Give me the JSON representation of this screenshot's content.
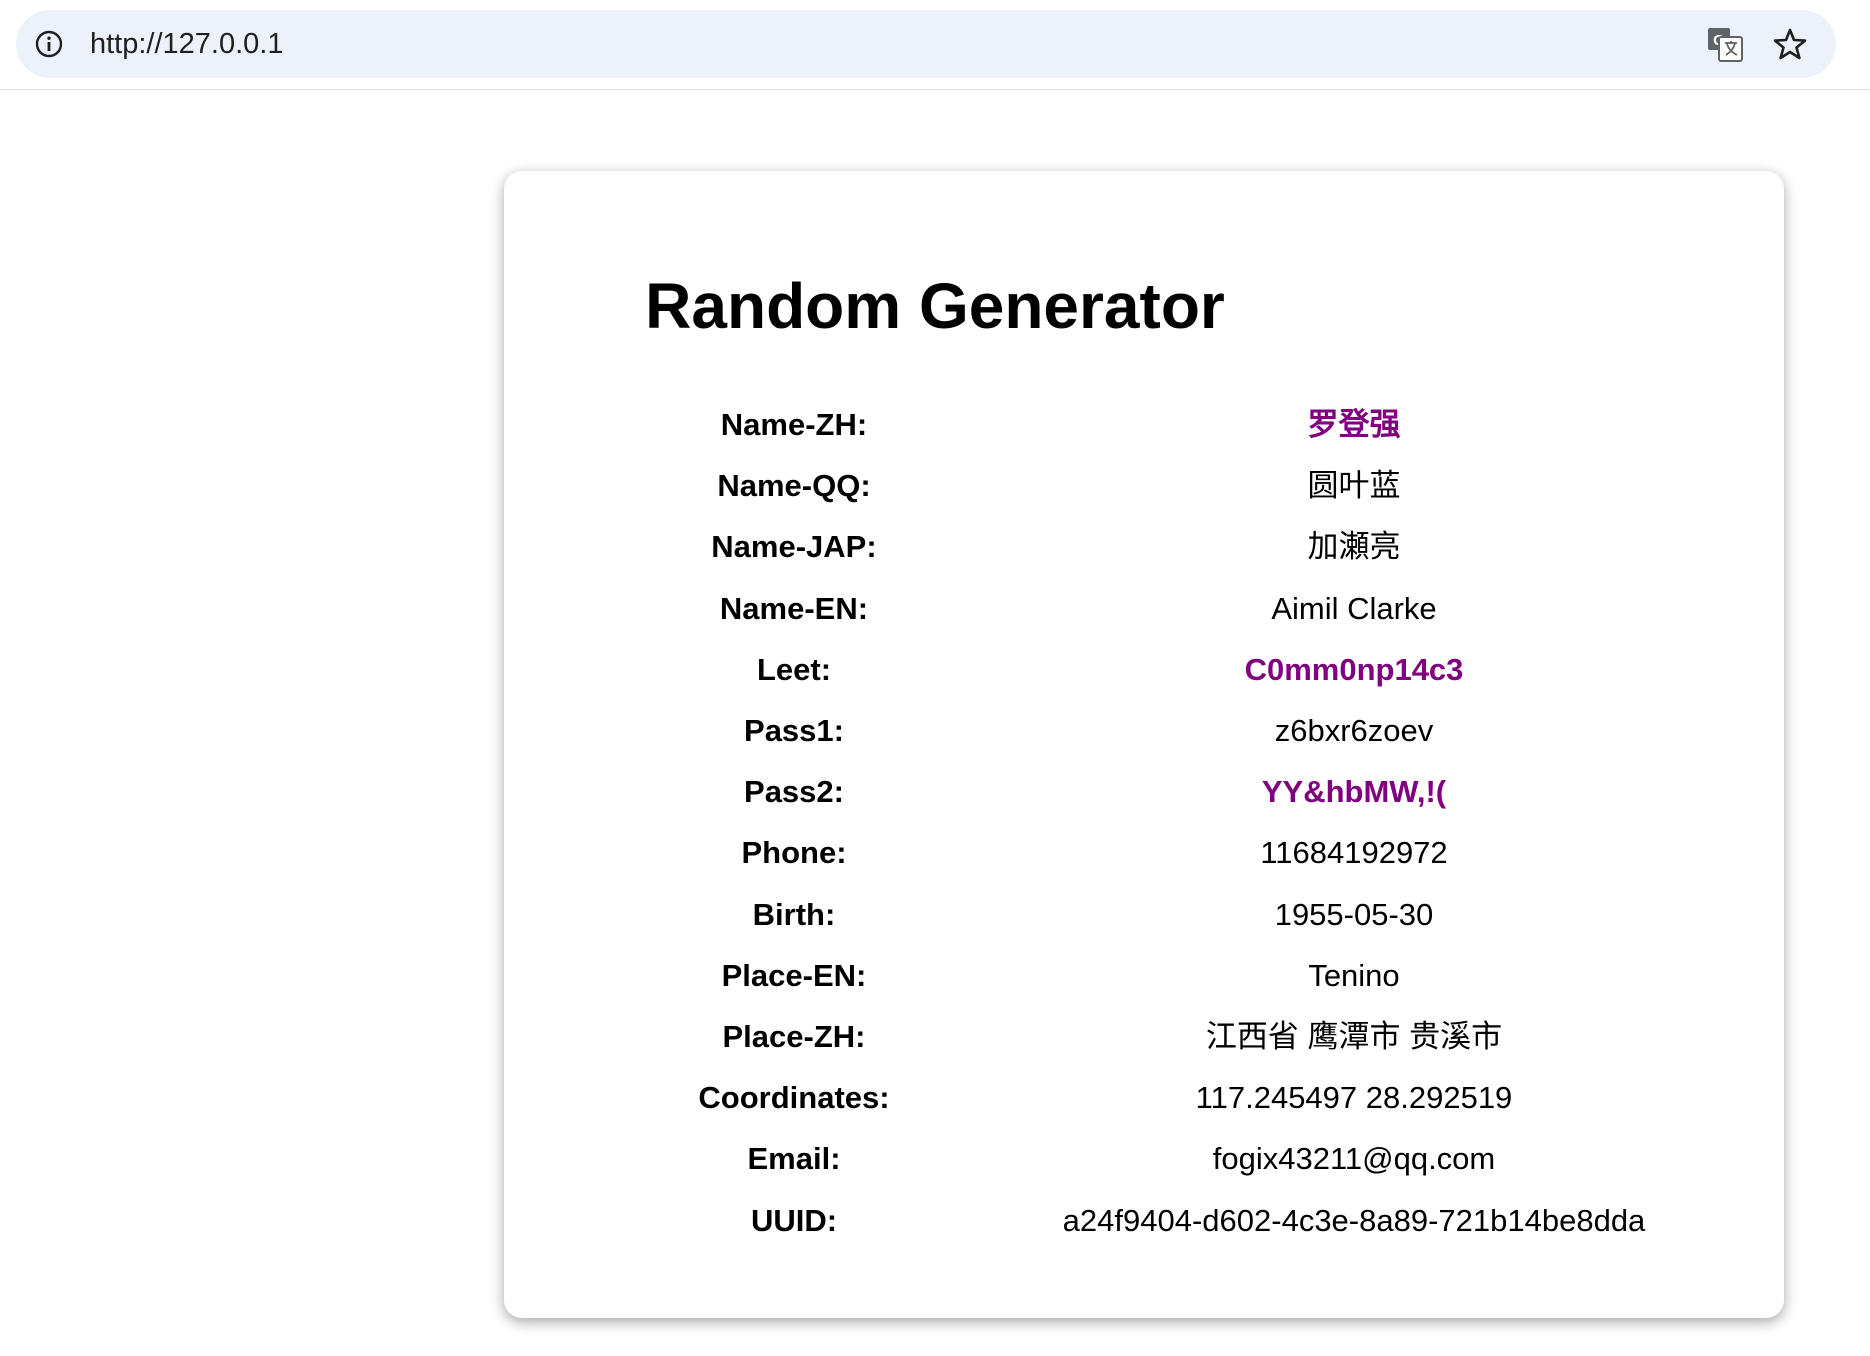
{
  "browser": {
    "url": "http://127.0.0.1"
  },
  "icons": {
    "info": "info-icon",
    "translate": "translate-icon",
    "bookmark": "star-icon"
  },
  "colors": {
    "highlight": "#800080",
    "omnibox": "#edf2fa"
  },
  "page": {
    "title": "Random Generator",
    "rows": [
      {
        "label": "Name-ZH:",
        "value": "罗登强",
        "highlight": true
      },
      {
        "label": "Name-QQ:",
        "value": "圆叶蓝",
        "highlight": false
      },
      {
        "label": "Name-JAP:",
        "value": "加瀬亮",
        "highlight": false
      },
      {
        "label": "Name-EN:",
        "value": "Aimil Clarke",
        "highlight": false
      },
      {
        "label": "Leet:",
        "value": "C0mm0np14c3",
        "highlight": true
      },
      {
        "label": "Pass1:",
        "value": "z6bxr6zoev",
        "highlight": false
      },
      {
        "label": "Pass2:",
        "value": "YY&hbMW,!(",
        "highlight": true
      },
      {
        "label": "Phone:",
        "value": "11684192972",
        "highlight": false
      },
      {
        "label": "Birth:",
        "value": "1955-05-30",
        "highlight": false
      },
      {
        "label": "Place-EN:",
        "value": "Tenino",
        "highlight": false
      },
      {
        "label": "Place-ZH:",
        "value": "江西省 鹰潭市 贵溪市",
        "highlight": false
      },
      {
        "label": "Coordinates:",
        "value": "117.245497 28.292519",
        "highlight": false
      },
      {
        "label": "Email:",
        "value": "fogix43211@qq.com",
        "highlight": false
      },
      {
        "label": "UUID:",
        "value": "a24f9404-d602-4c3e-8a89-721b14be8dda",
        "highlight": false
      }
    ]
  }
}
